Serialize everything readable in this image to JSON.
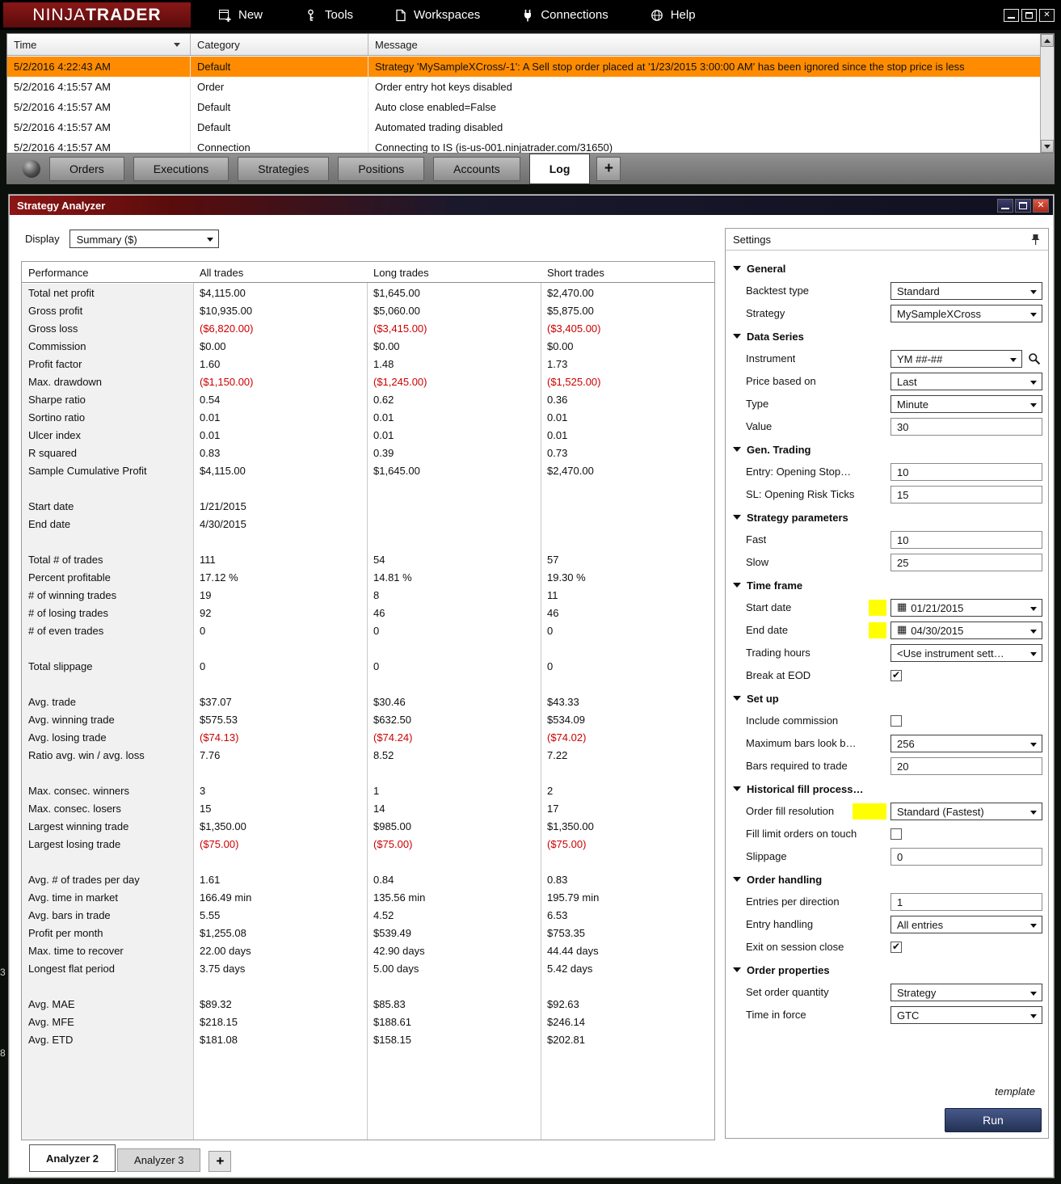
{
  "menubar": {
    "logo_part1": "NINJA",
    "logo_part2": "TRADER",
    "items": [
      {
        "label": "New"
      },
      {
        "label": "Tools"
      },
      {
        "label": "Workspaces"
      },
      {
        "label": "Connections"
      },
      {
        "label": "Help"
      }
    ]
  },
  "log": {
    "columns": [
      "Time",
      "Category",
      "Message"
    ],
    "rows": [
      {
        "time": "5/2/2016 4:22:43 AM",
        "category": "Default",
        "message": "Strategy 'MySampleXCross/-1': A Sell stop order placed at '1/23/2015 3:00:00 AM' has been ignored since the stop price is less",
        "highlighted": true
      },
      {
        "time": "5/2/2016 4:15:57 AM",
        "category": "Order",
        "message": "Order entry hot keys disabled",
        "highlighted": false
      },
      {
        "time": "5/2/2016 4:15:57 AM",
        "category": "Default",
        "message": "Auto close enabled=False",
        "highlighted": false
      },
      {
        "time": "5/2/2016 4:15:57 AM",
        "category": "Default",
        "message": "Automated trading disabled",
        "highlighted": false
      },
      {
        "time": "5/2/2016 4:15:57 AM",
        "category": "Connection",
        "message": "Connecting to IS (is-us-001.ninjatrader.com/31650)",
        "highlighted": false
      }
    ],
    "tabs": [
      "Orders",
      "Executions",
      "Strategies",
      "Positions",
      "Accounts",
      "Log"
    ],
    "active_tab": "Log",
    "add_tab_label": "+"
  },
  "analyzer": {
    "title": "Strategy Analyzer",
    "display_label": "Display",
    "display_value": "Summary ($)",
    "table": {
      "columns": [
        "Performance",
        "All trades",
        "Long trades",
        "Short trades"
      ],
      "rows": [
        {
          "label": "Total net profit",
          "all": "$4,115.00",
          "long": "$1,645.00",
          "short": "$2,470.00"
        },
        {
          "label": "Gross profit",
          "all": "$10,935.00",
          "long": "$5,060.00",
          "short": "$5,875.00"
        },
        {
          "label": "Gross loss",
          "all": "($6,820.00)",
          "long": "($3,415.00)",
          "short": "($3,405.00)"
        },
        {
          "label": "Commission",
          "all": "$0.00",
          "long": "$0.00",
          "short": "$0.00"
        },
        {
          "label": "Profit factor",
          "all": "1.60",
          "long": "1.48",
          "short": "1.73"
        },
        {
          "label": "Max. drawdown",
          "all": "($1,150.00)",
          "long": "($1,245.00)",
          "short": "($1,525.00)"
        },
        {
          "label": "Sharpe ratio",
          "all": "0.54",
          "long": "0.62",
          "short": "0.36"
        },
        {
          "label": "Sortino ratio",
          "all": "0.01",
          "long": "0.01",
          "short": "0.01"
        },
        {
          "label": "Ulcer index",
          "all": "0.01",
          "long": "0.01",
          "short": "0.01"
        },
        {
          "label": "R squared",
          "all": "0.83",
          "long": "0.39",
          "short": "0.73"
        },
        {
          "label": "Sample Cumulative Profit",
          "all": "$4,115.00",
          "long": "$1,645.00",
          "short": "$2,470.00"
        },
        {
          "label": "",
          "all": "",
          "long": "",
          "short": ""
        },
        {
          "label": "Start date",
          "all": "1/21/2015",
          "long": "",
          "short": ""
        },
        {
          "label": "End date",
          "all": "4/30/2015",
          "long": "",
          "short": ""
        },
        {
          "label": "",
          "all": "",
          "long": "",
          "short": ""
        },
        {
          "label": "Total # of trades",
          "all": "111",
          "long": "54",
          "short": "57"
        },
        {
          "label": "Percent profitable",
          "all": "17.12 %",
          "long": "14.81 %",
          "short": "19.30 %"
        },
        {
          "label": "# of winning trades",
          "all": "19",
          "long": "8",
          "short": "11"
        },
        {
          "label": "# of losing trades",
          "all": "92",
          "long": "46",
          "short": "46"
        },
        {
          "label": "# of even trades",
          "all": "0",
          "long": "0",
          "short": "0"
        },
        {
          "label": "",
          "all": "",
          "long": "",
          "short": ""
        },
        {
          "label": "Total slippage",
          "all": "0",
          "long": "0",
          "short": "0"
        },
        {
          "label": "",
          "all": "",
          "long": "",
          "short": ""
        },
        {
          "label": "Avg. trade",
          "all": "$37.07",
          "long": "$30.46",
          "short": "$43.33"
        },
        {
          "label": "Avg. winning trade",
          "all": "$575.53",
          "long": "$632.50",
          "short": "$534.09"
        },
        {
          "label": "Avg. losing trade",
          "all": "($74.13)",
          "long": "($74.24)",
          "short": "($74.02)"
        },
        {
          "label": "Ratio avg. win / avg. loss",
          "all": "7.76",
          "long": "8.52",
          "short": "7.22"
        },
        {
          "label": "",
          "all": "",
          "long": "",
          "short": ""
        },
        {
          "label": "Max. consec. winners",
          "all": "3",
          "long": "1",
          "short": "2"
        },
        {
          "label": "Max. consec. losers",
          "all": "15",
          "long": "14",
          "short": "17"
        },
        {
          "label": "Largest winning trade",
          "all": "$1,350.00",
          "long": "$985.00",
          "short": "$1,350.00"
        },
        {
          "label": "Largest losing trade",
          "all": "($75.00)",
          "long": "($75.00)",
          "short": "($75.00)"
        },
        {
          "label": "",
          "all": "",
          "long": "",
          "short": ""
        },
        {
          "label": "Avg. # of trades per day",
          "all": "1.61",
          "long": "0.84",
          "short": "0.83"
        },
        {
          "label": "Avg. time in market",
          "all": "166.49 min",
          "long": "135.56 min",
          "short": "195.79 min"
        },
        {
          "label": "Avg. bars in trade",
          "all": "5.55",
          "long": "4.52",
          "short": "6.53"
        },
        {
          "label": "Profit per month",
          "all": "$1,255.08",
          "long": "$539.49",
          "short": "$753.35"
        },
        {
          "label": "Max. time to recover",
          "all": "22.00 days",
          "long": "42.90 days",
          "short": "44.44 days"
        },
        {
          "label": "Longest flat period",
          "all": "3.75 days",
          "long": "5.00 days",
          "short": "5.42 days"
        },
        {
          "label": "",
          "all": "",
          "long": "",
          "short": ""
        },
        {
          "label": "Avg. MAE",
          "all": "$89.32",
          "long": "$85.83",
          "short": "$92.63"
        },
        {
          "label": "Avg. MFE",
          "all": "$218.15",
          "long": "$188.61",
          "short": "$246.14"
        },
        {
          "label": "Avg. ETD",
          "all": "$181.08",
          "long": "$158.15",
          "short": "$202.81"
        }
      ]
    },
    "tabs": [
      "Analyzer 2",
      "Analyzer 3"
    ],
    "active_tab": "Analyzer 2",
    "add_tab_label": "+"
  },
  "settings": {
    "title": "Settings",
    "sections": [
      {
        "title": "General",
        "items": [
          {
            "label": "Backtest type",
            "control": "dropdown",
            "value": "Standard"
          },
          {
            "label": "Strategy",
            "control": "dropdown",
            "value": "MySampleXCross"
          }
        ]
      },
      {
        "title": "Data Series",
        "items": [
          {
            "label": "Instrument",
            "control": "instrument",
            "value": "YM ##-##"
          },
          {
            "label": "Price based on",
            "control": "dropdown",
            "value": "Last"
          },
          {
            "label": "Type",
            "control": "dropdown",
            "value": "Minute"
          },
          {
            "label": "Value",
            "control": "input",
            "value": "30"
          }
        ]
      },
      {
        "title": "Gen. Trading",
        "items": [
          {
            "label": "Entry: Opening Stop…",
            "control": "input",
            "value": "10"
          },
          {
            "label": "SL: Opening Risk Ticks",
            "control": "input",
            "value": "15"
          }
        ]
      },
      {
        "title": "Strategy parameters",
        "items": [
          {
            "label": "Fast",
            "control": "input",
            "value": "10"
          },
          {
            "label": "Slow",
            "control": "input",
            "value": "25"
          }
        ]
      },
      {
        "title": "Time frame",
        "items": [
          {
            "label": "Start date",
            "control": "date",
            "value": "01/21/2015",
            "highlight": 22
          },
          {
            "label": "End date",
            "control": "date",
            "value": "04/30/2015",
            "highlight": 22
          },
          {
            "label": "Trading hours",
            "control": "dropdown",
            "value": "<Use instrument sett…"
          },
          {
            "label": "Break at EOD",
            "control": "checkbox",
            "checked": true
          }
        ]
      },
      {
        "title": "Set up",
        "items": [
          {
            "label": "Include commission",
            "control": "checkbox",
            "checked": false
          },
          {
            "label": "Maximum bars look b…",
            "control": "dropdown",
            "value": "256"
          },
          {
            "label": "Bars required to trade",
            "control": "input",
            "value": "20"
          }
        ]
      },
      {
        "title": "Historical fill process…",
        "items": [
          {
            "label": "Order fill resolution",
            "control": "dropdown",
            "value": "Standard (Fastest)",
            "highlight": 42
          },
          {
            "label": "Fill limit orders on touch",
            "control": "checkbox",
            "checked": false
          },
          {
            "label": "Slippage",
            "control": "input",
            "value": "0"
          }
        ]
      },
      {
        "title": "Order handling",
        "items": [
          {
            "label": "Entries per direction",
            "control": "input",
            "value": "1"
          },
          {
            "label": "Entry handling",
            "control": "dropdown",
            "value": "All entries"
          },
          {
            "label": "Exit on session close",
            "control": "checkbox",
            "checked": true
          }
        ]
      },
      {
        "title": "Order properties",
        "items": [
          {
            "label": "Set order quantity",
            "control": "dropdown",
            "value": "Strategy"
          },
          {
            "label": "Time in force",
            "control": "dropdown",
            "value": "GTC"
          }
        ]
      }
    ],
    "template_label": "template",
    "run_label": "Run"
  },
  "artifacts": [
    "3",
    "8"
  ],
  "colors": {
    "highlight_row": "#FF8C00",
    "negative_value": "#CC0000",
    "yellow_mark": "#FFFF00",
    "title_red": "#7A1212",
    "run_button": "#2E4169"
  }
}
